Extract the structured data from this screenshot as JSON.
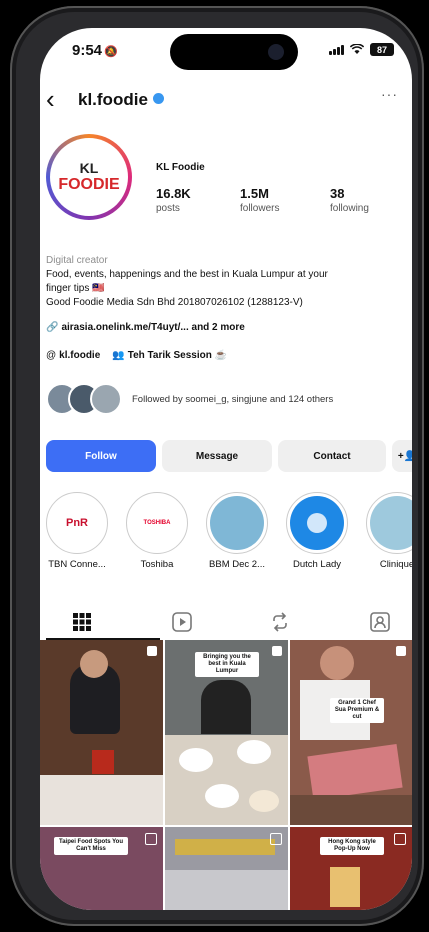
{
  "status": {
    "time": "9:54",
    "time_extra": "🔕",
    "battery": "87"
  },
  "header": {
    "handle": "kl.foodie",
    "more": "···",
    "back": "‹"
  },
  "profile": {
    "avatar_line1": "KL",
    "avatar_line2": "FOODIE",
    "display_name": "KL Foodie",
    "stats": [
      {
        "value": "16.8K",
        "label": "posts"
      },
      {
        "value": "1.5M",
        "label": "followers"
      },
      {
        "value": "38",
        "label": "following"
      }
    ],
    "category": "Digital creator",
    "bio_line1": "Food, events, happenings and the best in Kuala Lumpur at your",
    "bio_line2": "finger tips 🇲🇾",
    "bio_line3": "Good Foodie Media Sdn Bhd 201807026102 (1288123-V)",
    "link": "airasia.onelink.me/T4uyt/... and 2 more",
    "threads_handle": "kl.foodie",
    "channel": "Teh Tarik Session ☕",
    "followed_by": "Followed by soomei_g, singjune and 124 others"
  },
  "actions": {
    "follow": "Follow",
    "message": "Message",
    "contact": "Contact",
    "add_user": "+👤"
  },
  "highlights": [
    {
      "label": "TBN Conne...",
      "text": "PnR",
      "bg": "#ffffff",
      "fg": "#c8102e"
    },
    {
      "label": "Toshiba",
      "text": "TOSHIBA",
      "bg": "#ffffff",
      "fg": "#e4002b"
    },
    {
      "label": "BBM Dec 2...",
      "text": "",
      "bg": "#7fb7d6",
      "fg": "#222"
    },
    {
      "label": "Dutch Lady",
      "text": "",
      "bg": "#1e88e5",
      "fg": "#fff"
    },
    {
      "label": "Clinique",
      "text": "",
      "bg": "#9ec9dd",
      "fg": "#fff"
    }
  ],
  "posts": [
    {
      "bg": "#5a3a2a",
      "caption": ""
    },
    {
      "bg": "#6b6f6f",
      "caption": "Bringing you the best in Kuala Lumpur"
    },
    {
      "bg": "#8a5a4a",
      "caption": "Grand 1 Chef Sua Premium & cut"
    },
    {
      "bg": "#7a4a60",
      "caption": "Taipei Food Spots You Can't Miss"
    },
    {
      "bg": "#9a9aa2",
      "caption": ""
    },
    {
      "bg": "#8a2a22",
      "caption": "Hong Kong style Pop-Up Now"
    }
  ],
  "colors": {
    "accent": "#3d6ef5",
    "verified": "#3897f0"
  }
}
